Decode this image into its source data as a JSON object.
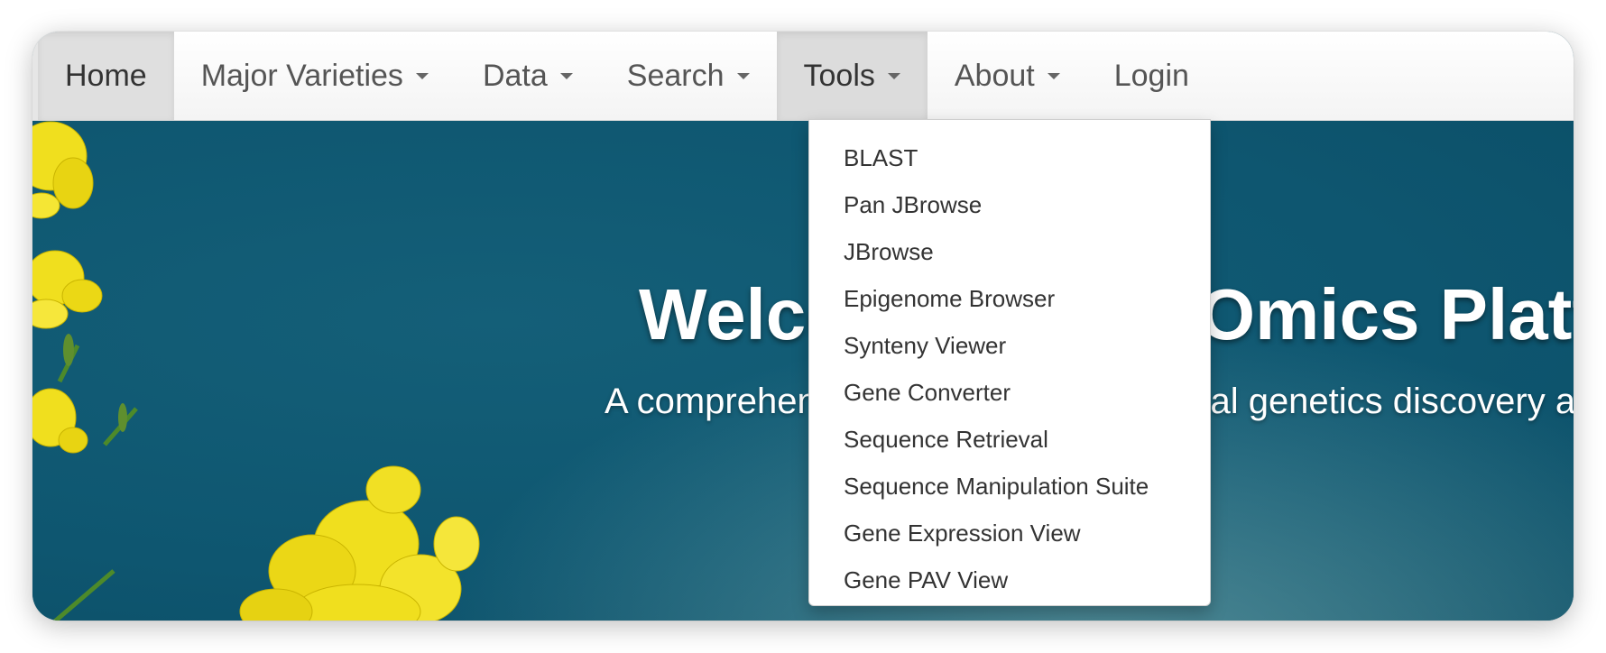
{
  "navbar": {
    "items": [
      {
        "label": "Home",
        "caret": false
      },
      {
        "label": "Major Varieties",
        "caret": true
      },
      {
        "label": "Data",
        "caret": true
      },
      {
        "label": "Search",
        "caret": true
      },
      {
        "label": "Tools",
        "caret": true
      },
      {
        "label": "About",
        "caret": true
      },
      {
        "label": "Login",
        "caret": false
      }
    ],
    "active": "Home",
    "open": "Tools"
  },
  "tools_menu": {
    "items": [
      "BLAST",
      "Pan JBrowse",
      "JBrowse",
      "Epigenome Browser",
      "Synteny Viewer",
      "Gene Converter",
      "Sequence Retrieval",
      "Sequence Manipulation Suite",
      "Gene Expression View",
      "Gene PAV View"
    ]
  },
  "hero": {
    "title": "Welcome to BnaOmics Platform",
    "subtitle": "A comprehensive platform for functional genetics discovery and"
  },
  "colors": {
    "hero_bg": "#0f5b73",
    "flower": "#f2e21b",
    "nav_text": "#555555"
  }
}
